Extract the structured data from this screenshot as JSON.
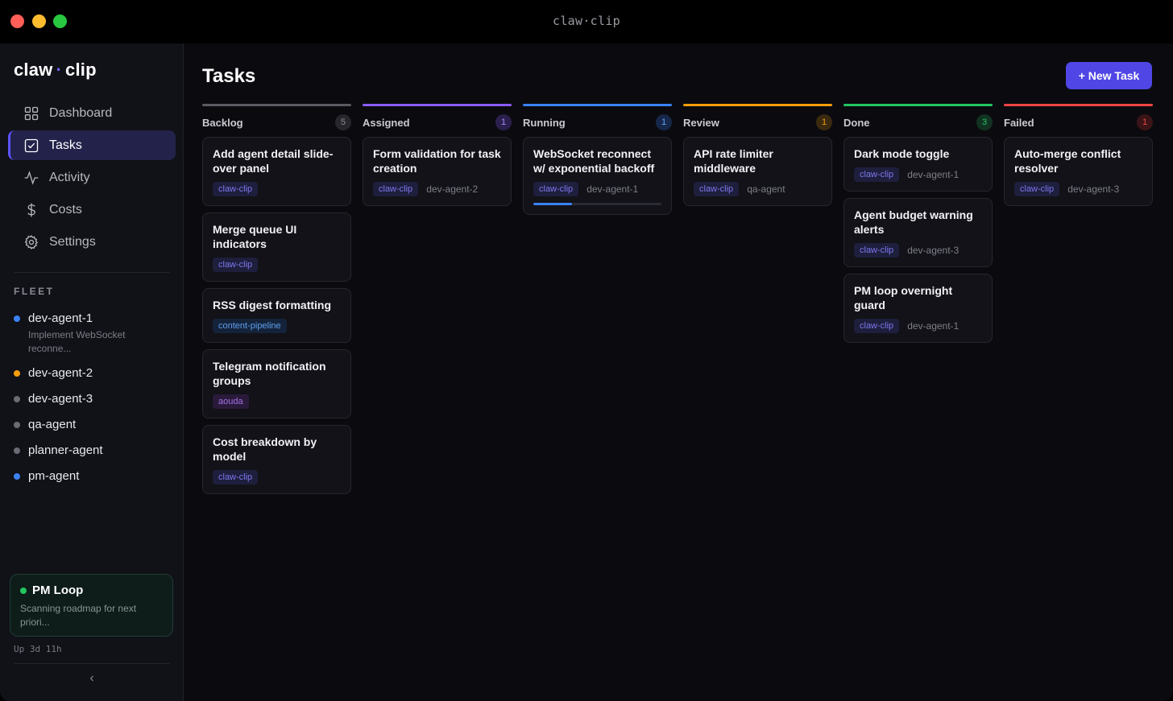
{
  "window": {
    "title": "claw·clip"
  },
  "sidebar": {
    "logo_left": "claw",
    "logo_dot": "·",
    "logo_right": "clip",
    "nav": [
      {
        "label": "Dashboard",
        "icon": "grid-icon",
        "active": false
      },
      {
        "label": "Tasks",
        "icon": "checkbox-icon",
        "active": true
      },
      {
        "label": "Activity",
        "icon": "pulse-icon",
        "active": false
      },
      {
        "label": "Costs",
        "icon": "dollar-icon",
        "active": false
      },
      {
        "label": "Settings",
        "icon": "gear-icon",
        "active": false
      }
    ],
    "fleet_label": "FLEET",
    "agents": [
      {
        "name": "dev-agent-1",
        "task": "Implement WebSocket reconne...",
        "status_color": "#3b82f6"
      },
      {
        "name": "dev-agent-2",
        "task": "",
        "status_color": "#f59e0b"
      },
      {
        "name": "dev-agent-3",
        "task": "",
        "status_color": "#6b6b75"
      },
      {
        "name": "qa-agent",
        "task": "",
        "status_color": "#6b6b75"
      },
      {
        "name": "planner-agent",
        "task": "",
        "status_color": "#6b6b75"
      },
      {
        "name": "pm-agent",
        "task": "",
        "status_color": "#3b82f6"
      }
    ],
    "pm_loop": {
      "title": "PM Loop",
      "subtitle": "Scanning roadmap for next priori..."
    },
    "uptime": "Up 3d 11h",
    "collapse_glyph": "‹"
  },
  "main": {
    "title": "Tasks",
    "new_task_label": "+ New Task",
    "columns": [
      {
        "name": "Backlog",
        "count": "5",
        "color": "#5a5a62",
        "count_bg": "#26262c",
        "count_fg": "#8a8a94",
        "cards": [
          {
            "title": "Add agent detail slide-over panel",
            "tag": "claw-clip",
            "tag_kind": "claw",
            "agent": ""
          },
          {
            "title": "Merge queue UI indicators",
            "tag": "claw-clip",
            "tag_kind": "claw",
            "agent": ""
          },
          {
            "title": "RSS digest formatting",
            "tag": "content-pipeline",
            "tag_kind": "content",
            "agent": ""
          },
          {
            "title": "Telegram notification groups",
            "tag": "aouda",
            "tag_kind": "aouda",
            "agent": ""
          },
          {
            "title": "Cost breakdown by model",
            "tag": "claw-clip",
            "tag_kind": "claw",
            "agent": ""
          }
        ]
      },
      {
        "name": "Assigned",
        "count": "1",
        "color": "#8b5cf6",
        "count_bg": "#2b1f4d",
        "count_fg": "#a78bfa",
        "cards": [
          {
            "title": "Form validation for task creation",
            "tag": "claw-clip",
            "tag_kind": "claw",
            "agent": "dev-agent-2"
          }
        ]
      },
      {
        "name": "Running",
        "count": "1",
        "color": "#3b82f6",
        "count_bg": "#17274a",
        "count_fg": "#60a5fa",
        "cards": [
          {
            "title": "WebSocket reconnect w/ exponential backoff",
            "tag": "claw-clip",
            "tag_kind": "claw",
            "agent": "dev-agent-1",
            "progress": 0.3
          }
        ]
      },
      {
        "name": "Review",
        "count": "1",
        "color": "#f59e0b",
        "count_bg": "#3a2a10",
        "count_fg": "#f59e0b",
        "cards": [
          {
            "title": "API rate limiter middleware",
            "tag": "claw-clip",
            "tag_kind": "claw",
            "agent": "qa-agent"
          }
        ]
      },
      {
        "name": "Done",
        "count": "3",
        "color": "#22c55e",
        "count_bg": "#123222",
        "count_fg": "#22c55e",
        "cards": [
          {
            "title": "Dark mode toggle",
            "tag": "claw-clip",
            "tag_kind": "claw",
            "agent": "dev-agent-1"
          },
          {
            "title": "Agent budget warning alerts",
            "tag": "claw-clip",
            "tag_kind": "claw",
            "agent": "dev-agent-3"
          },
          {
            "title": "PM loop overnight guard",
            "tag": "claw-clip",
            "tag_kind": "claw",
            "agent": "dev-agent-1"
          }
        ]
      },
      {
        "name": "Failed",
        "count": "1",
        "color": "#ef4444",
        "count_bg": "#3a1416",
        "count_fg": "#ef4444",
        "cards": [
          {
            "title": "Auto-merge conflict resolver",
            "tag": "claw-clip",
            "tag_kind": "claw",
            "agent": "dev-agent-3"
          }
        ]
      }
    ]
  }
}
